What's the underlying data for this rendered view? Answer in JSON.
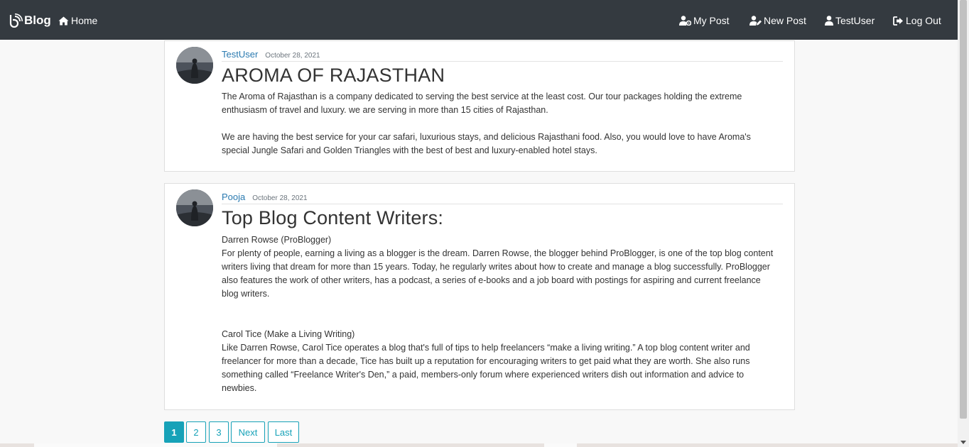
{
  "navbar": {
    "brand": "Blog",
    "home": "Home",
    "my_post": "My Post",
    "new_post": "New Post",
    "user": "TestUser",
    "log_out": "Log Out"
  },
  "posts": [
    {
      "author": "TestUser",
      "date": "October 28, 2021",
      "title": "AROMA OF RAJASTHAN",
      "paragraphs": [
        "The Aroma of Rajasthan is a company dedicated to serving the best service at the least cost. Our tour packages holding the extreme enthusiasm of travel and luxury. we are serving in more than 15 cities of Rajasthan.",
        "We are having the best service for your car safari, luxurious stays, and delicious Rajasthani food. Also, you would love to have Aroma's special Jungle Safari and Golden Triangles with the best of best and luxury-enabled hotel stays."
      ]
    },
    {
      "author": "Pooja",
      "date": "October 28, 2021",
      "title": "Top Blog Content Writers:",
      "paragraphs": [
        "Darren Rowse (ProBlogger)",
        "For plenty of people, earning a living as a blogger is the dream. Darren Rowse, the blogger behind ProBlogger, is one of the top blog content writers living that dream for more than 15 years. Today, he regularly writes about how to create and manage a blog successfully. ProBlogger also features the work of other writers, has a podcast, a series of e-books and a job board with postings for aspiring and current freelance blog writers.",
        "Carol Tice (Make a Living Writing)",
        "Like Darren Rowse, Carol Tice operates a blog that's full of tips to help freelancers “make a living writing.” A top blog content writer and freelancer for more than a decade, Tice has built up a reputation for encouraging writers to get paid what they are worth. She also runs something called “Freelance Writer's Den,” a paid, members-only forum where experienced writers dish out information and advice to newbies."
      ]
    }
  ],
  "pagination": {
    "pages": [
      "1",
      "2",
      "3"
    ],
    "next": "Next",
    "last": "Last",
    "active": "1"
  },
  "colors": {
    "navbar": "#343a40",
    "link": "#2a7ab0",
    "pager": "#17a2b8"
  }
}
